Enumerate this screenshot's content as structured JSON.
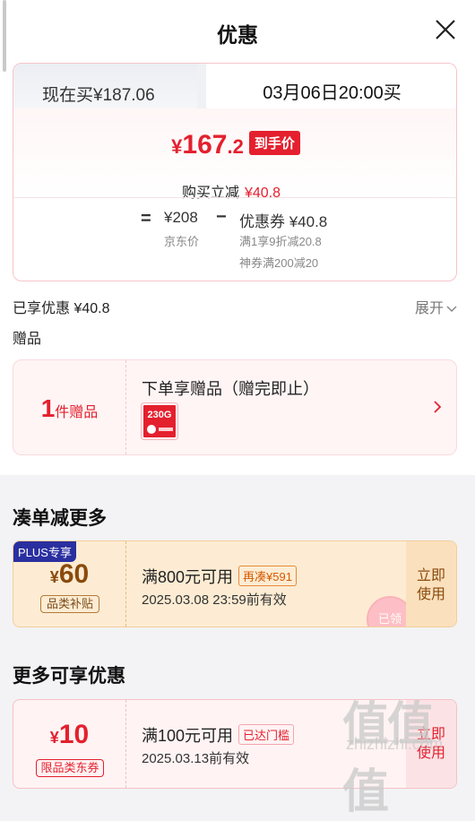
{
  "header": {
    "title": "优惠"
  },
  "tabs": {
    "now": "现在买¥187.06",
    "later": "03月06日20:00买"
  },
  "price": {
    "yen": "¥",
    "integer": "167",
    "decimal": ".2",
    "tag": "到手价",
    "cut_label": "购买立减",
    "cut_amount": "¥40.8"
  },
  "breakdown": {
    "equals": "=",
    "base_price": "¥208",
    "base_label": "京东价",
    "minus": "−",
    "coupon_price": "优惠券 ¥40.8",
    "coupon_line1": "满1享9折减20.8",
    "coupon_line2": "神券满200减20"
  },
  "enjoyed": {
    "text": "已享优惠 ¥40.8",
    "expand": "展开"
  },
  "gift": {
    "heading": "赠品",
    "count": "1",
    "unit": "件赠品",
    "title": "下单享赠品（赠完即止）",
    "image_text": "230G"
  },
  "more_section": {
    "title": "凑单减更多",
    "coupon": {
      "plus_tag": "PLUS专享",
      "yen": "¥",
      "value": "60",
      "sub": "品类补贴",
      "condition": "满800元可用",
      "tag": "再凑¥591",
      "date": "2025.03.08 23:59前有效",
      "button": [
        "立即",
        "使用"
      ],
      "stamp": "已领"
    }
  },
  "extra_section": {
    "title": "更多可享优惠",
    "coupon": {
      "yen": "¥",
      "value": "10",
      "sub": "限品类东券",
      "condition": "满100元可用",
      "tag": "已达门槛",
      "date": "2025.03.13前有效",
      "button": [
        "立即",
        "使用"
      ]
    }
  },
  "watermark": {
    "glyphs": "值值值",
    "site": "zhizhizhi.com"
  },
  "colors": {
    "accent": "#e4202e",
    "gold": "#8a4a0c",
    "plus": "#2a2fa0"
  }
}
